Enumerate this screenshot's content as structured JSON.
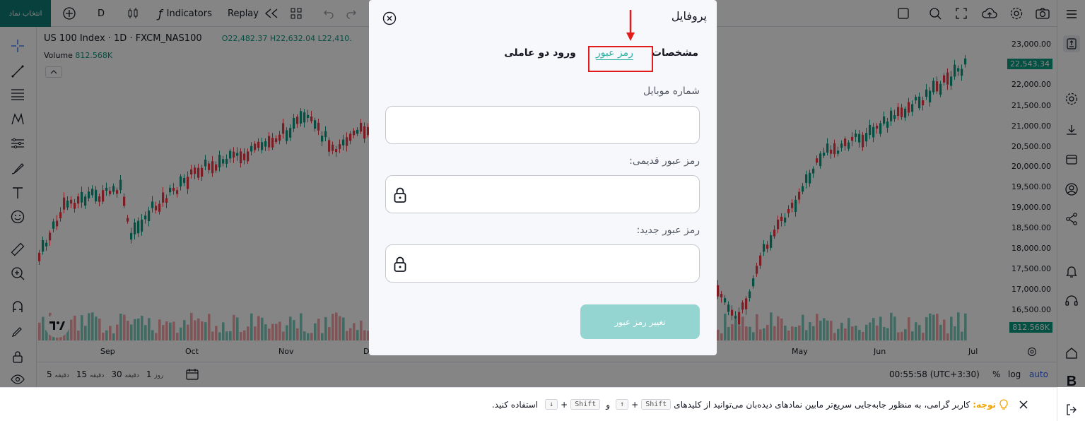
{
  "topbar": {
    "symbol_button": "انتخاب نماد",
    "interval": "D",
    "indicators_label": "Indicators",
    "replay_label": "Replay"
  },
  "chart": {
    "legend": {
      "symbol": "US 100 Index · 1D · FXCM_NAS100",
      "ohlc": "O22,482.37 H22,632.04 L22,410.",
      "volume_label": "Volume",
      "volume_value": "812.568K"
    },
    "price_labels": [
      "23,000.00",
      "22,000.00",
      "21,500.00",
      "21,000.00",
      "20,500.00",
      "20,000.00",
      "19,500.00",
      "19,000.00",
      "18,500.00",
      "18,000.00",
      "17,500.00",
      "17,000.00",
      "16,500.00"
    ],
    "current_price": "22,543.34",
    "volume_tag": "812.568K",
    "time_labels": [
      "Sep",
      "Oct",
      "Nov",
      "D",
      "May",
      "Jun",
      "Jul"
    ],
    "clock": "00:55:58 (UTC+3:30)",
    "scale_percent": "%",
    "scale_log": "log",
    "scale_auto": "auto",
    "timeframes": [
      {
        "num": "5",
        "unit": "دقیقه"
      },
      {
        "num": "15",
        "unit": "دقیقه"
      },
      {
        "num": "30",
        "unit": "دقیقه"
      },
      {
        "num": "1",
        "unit": "روز"
      }
    ]
  },
  "notice": {
    "prefix": "توجه:",
    "text1": "کاربر گرامی، به منظور جابه‌جایی سریع‌تر مابین نمادهای دیده‌بان می‌توانید از کلیدهای",
    "key_shift": "Shift",
    "plus": "+",
    "and": "و",
    "text2": "استفاده کنید."
  },
  "modal": {
    "title": "پروفایل",
    "tabs": [
      "مشخصات",
      "رمز عبور",
      "ورود دو عاملی"
    ],
    "mobile_label": "شماره موبایل",
    "mobile_value": "",
    "old_password_label": "رمز عبور قدیمی:",
    "new_password_label": "رمز عبور جدید:",
    "submit_label": "تغییر رمز عبور"
  },
  "colors": {
    "accent": "#2bb1a4",
    "up": "#089981",
    "down": "#f23645",
    "highlight": "#e31b1b"
  }
}
